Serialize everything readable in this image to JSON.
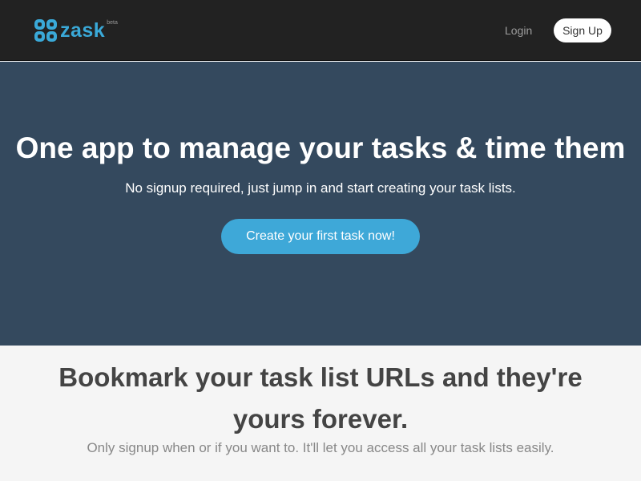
{
  "nav": {
    "brand": "zask",
    "brand_badge": "beta",
    "logo_icon": "clover-logo-icon",
    "login_label": "Login",
    "signup_label": "Sign Up"
  },
  "hero": {
    "title": "One app to manage your tasks & time them",
    "subtitle": "No signup required, just jump in and start creating your task lists.",
    "cta_label": "Create your first task now!"
  },
  "features": {
    "title": "Bookmark your task list URLs and they're yours forever.",
    "subtitle": "Only signup when or if you want to. It'll let you access all your task lists easily."
  },
  "colors": {
    "navbar_bg": "#222222",
    "hero_bg": "#34495e",
    "accent": "#3ea8d8",
    "features_bg": "#f5f5f5"
  }
}
